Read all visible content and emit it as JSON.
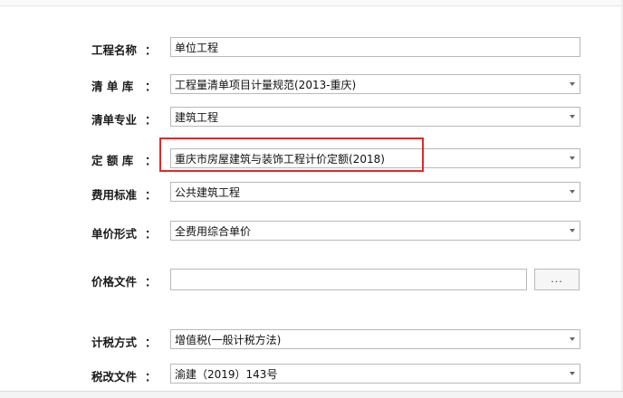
{
  "form": {
    "project_name": {
      "label": "工程名称",
      "colon": "：",
      "value": "单位工程"
    },
    "bill_library": {
      "label": "清 单 库",
      "colon": "：",
      "value": "工程量清单项目计量规范(2013-重庆)"
    },
    "bill_specialty": {
      "label": "清单专业",
      "colon": "：",
      "value": "建筑工程"
    },
    "quota_library": {
      "label": "定 额 库",
      "colon": "：",
      "value": "重庆市房屋建筑与装饰工程计价定额(2018)"
    },
    "fee_standard": {
      "label": "费用标准",
      "colon": "：",
      "value": "公共建筑工程"
    },
    "unit_price_form": {
      "label": "单价形式",
      "colon": "：",
      "value": "全费用综合单价"
    },
    "price_file": {
      "label": "价格文件",
      "colon": "：",
      "value": "",
      "browse_label": "..."
    },
    "tax_method": {
      "label": "计税方式",
      "colon": "：",
      "value": "增值税(一般计税方法)"
    },
    "tax_reform_file": {
      "label": "税改文件",
      "colon": "：",
      "value": "渝建（2019）143号"
    }
  },
  "colors": {
    "highlight": "#e02a2a",
    "border": "#b9b9b9"
  },
  "icons": {
    "dropdown": "chevron-down-icon"
  }
}
